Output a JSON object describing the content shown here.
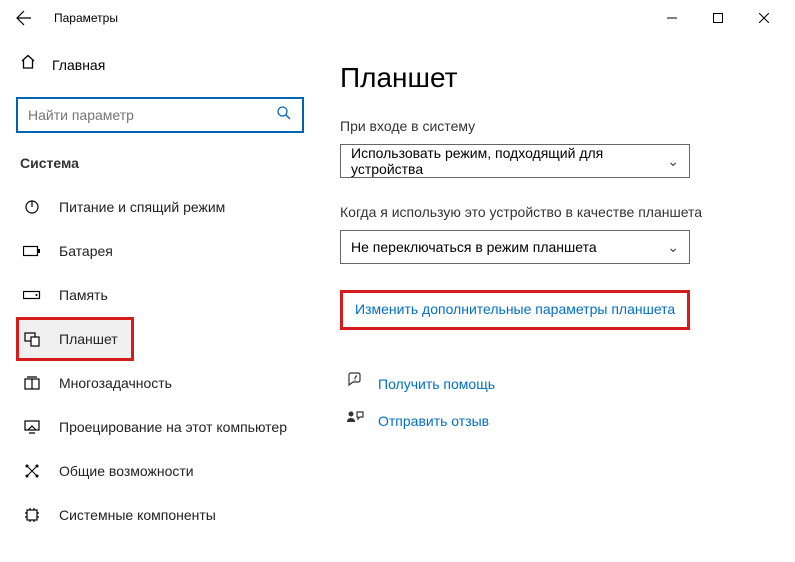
{
  "titlebar": {
    "title": "Параметры"
  },
  "sidebar": {
    "home": "Главная",
    "search_placeholder": "Найти параметр",
    "section": "Система",
    "items": [
      {
        "label": "Питание и спящий режим"
      },
      {
        "label": "Батарея"
      },
      {
        "label": "Память"
      },
      {
        "label": "Планшет"
      },
      {
        "label": "Многозадачность"
      },
      {
        "label": "Проецирование на этот компьютер"
      },
      {
        "label": "Общие возможности"
      },
      {
        "label": "Системные компоненты"
      }
    ]
  },
  "main": {
    "title": "Планшет",
    "signin_label": "При входе в систему",
    "signin_value": "Использовать режим, подходящий для устройства",
    "tablet_label": "Когда я использую это устройство в качестве планшета",
    "tablet_value": "Не переключаться в режим планшета",
    "extra_link": "Изменить дополнительные параметры планшета",
    "help": "Получить помощь",
    "feedback": "Отправить отзыв"
  }
}
